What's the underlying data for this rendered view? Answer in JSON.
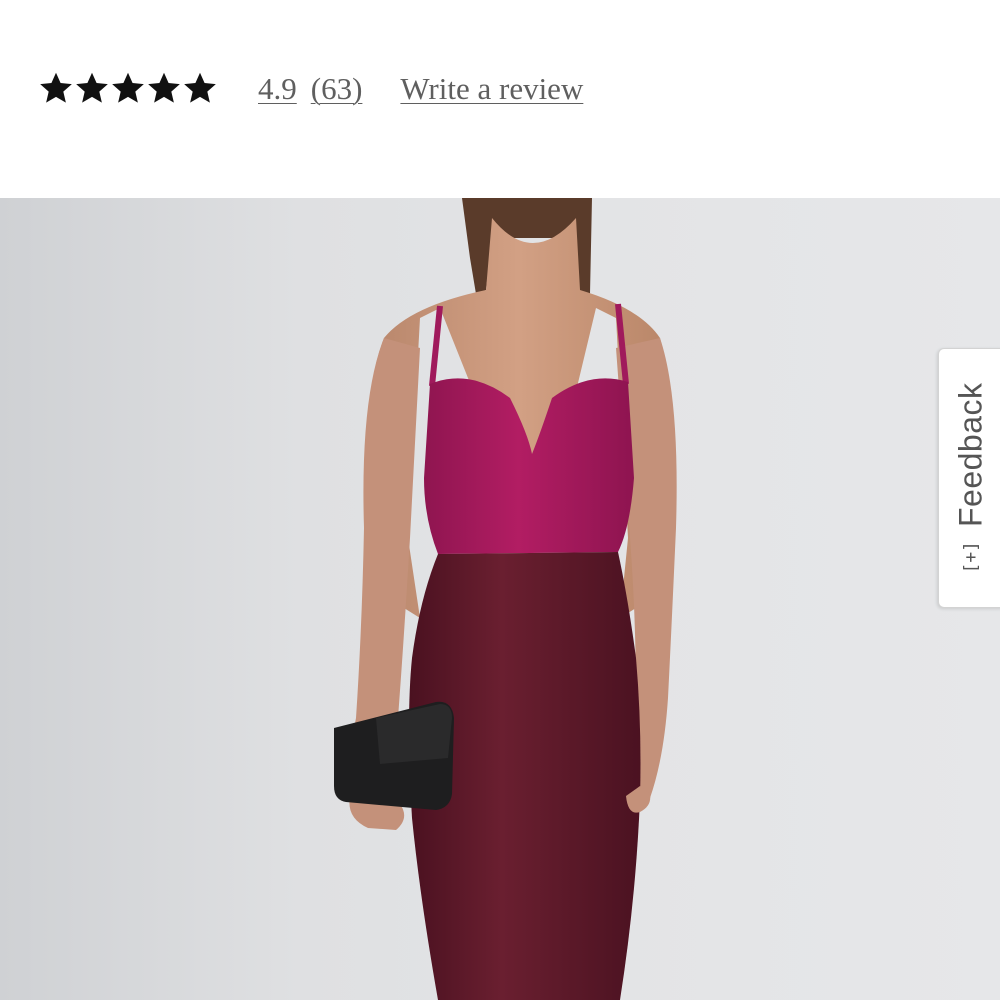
{
  "rating": {
    "stars_filled": 5,
    "stars_total": 5,
    "value": "4.9",
    "count": "(63)",
    "write_review_label": "Write a review"
  },
  "icons": {
    "star": "star-icon",
    "feedback": "feedback-plus-icon"
  },
  "product_image": {
    "alt": "Model wearing a two-tone magenta and burgundy sleeveless sheath dress holding a black clutch"
  },
  "feedback": {
    "icon_glyph": "[+]",
    "label": "Feedback"
  },
  "colors": {
    "stars": "#111111",
    "link_text": "#5f5f5f",
    "dress_top": "#a3185a",
    "dress_skirt": "#5a1a28"
  }
}
